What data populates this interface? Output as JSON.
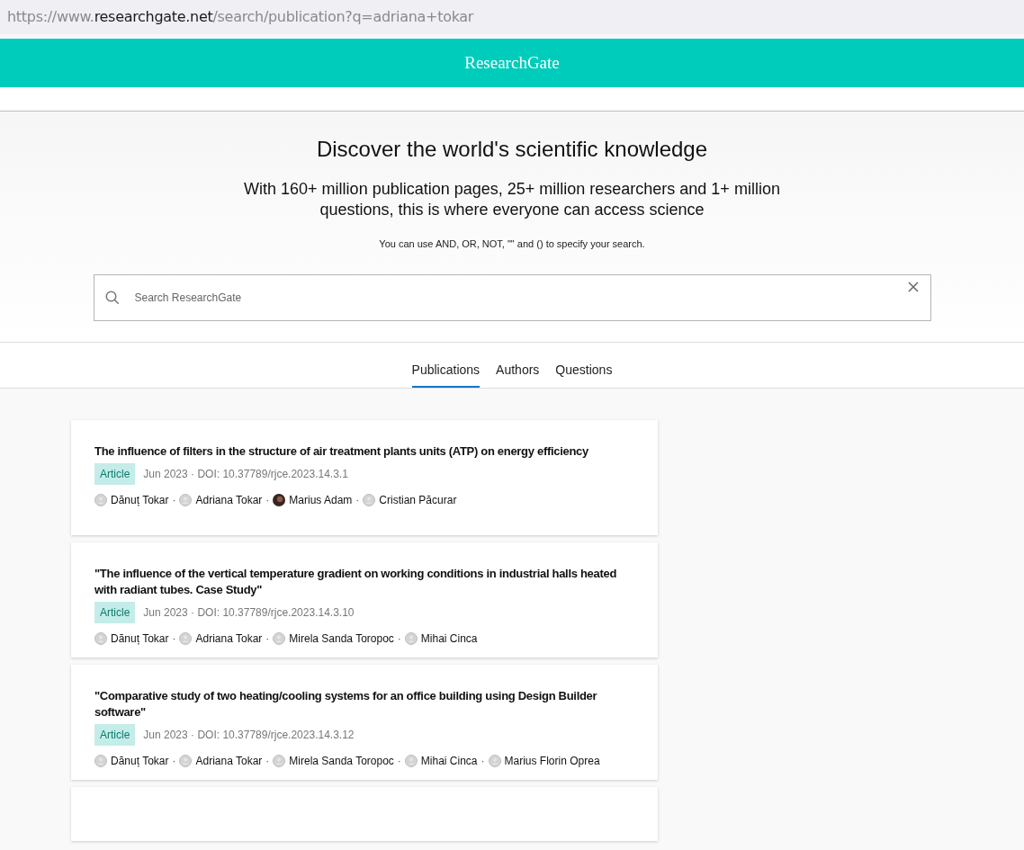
{
  "address_bar": {
    "scheme": "https://www.",
    "host": "researchgate.net",
    "path": "/search/publication?q=adriana+tokar"
  },
  "header": {
    "logo": "ResearchGate"
  },
  "hero": {
    "title": "Discover the world's scientific knowledge",
    "subtitle": "With 160+ million publication pages, 25+ million researchers and 1+ million questions, this is where everyone can access science",
    "hint": "You can use AND, OR, NOT, \"\" and () to specify your search."
  },
  "search": {
    "placeholder": "Search ResearchGate"
  },
  "tabs": [
    {
      "label": "Publications",
      "selected": true
    },
    {
      "label": "Authors",
      "selected": false
    },
    {
      "label": "Questions",
      "selected": false
    }
  ],
  "results": [
    {
      "title": "The influence of filters in the structure of air treatment plants units (ATP) on energy efficiency",
      "type": "Article",
      "meta": "Jun 2023 · DOI: 10.37789/rjce.2023.14.3.1",
      "authors": [
        {
          "name": "Dănuț Tokar",
          "kind": "placeholder",
          "separator": "·"
        },
        {
          "name": "Adriana Tokar",
          "kind": "placeholder",
          "separator": "·"
        },
        {
          "name": "Marius Adam",
          "kind": "photo",
          "separator": "·"
        },
        {
          "name": "Cristian Păcurar",
          "kind": "placeholder"
        }
      ]
    },
    {
      "title": "\"The influence of the vertical temperature gradient on working conditions in industrial halls heated with radiant tubes. Case Study\"",
      "type": "Article",
      "meta": "Jun 2023 · DOI: 10.37789/rjce.2023.14.3.10",
      "authors": [
        {
          "name": "Dănuț Tokar",
          "kind": "placeholder",
          "separator": "·"
        },
        {
          "name": "Adriana Tokar",
          "kind": "placeholder",
          "separator": "·"
        },
        {
          "name": "Mirela Sanda Toropoc",
          "kind": "placeholder",
          "separator": "·"
        },
        {
          "name": "Mihai Cinca",
          "kind": "placeholder"
        }
      ]
    },
    {
      "title": "\"Comparative study of two heating/cooling systems for an office building using Design Builder software\"",
      "type": "Article",
      "meta": "Jun 2023 · DOI: 10.37789/rjce.2023.14.3.12",
      "authors": [
        {
          "name": "Dănuț Tokar",
          "kind": "placeholder",
          "separator": "·"
        },
        {
          "name": "Adriana Tokar",
          "kind": "placeholder",
          "separator": "·"
        },
        {
          "name": "Mirela Sanda Toropoc",
          "kind": "placeholder",
          "separator": "·"
        },
        {
          "name": "Mihai Cinca",
          "kind": "placeholder",
          "separator": "·"
        },
        {
          "name": "Marius Florin Oprea",
          "kind": "placeholder"
        }
      ]
    }
  ]
}
